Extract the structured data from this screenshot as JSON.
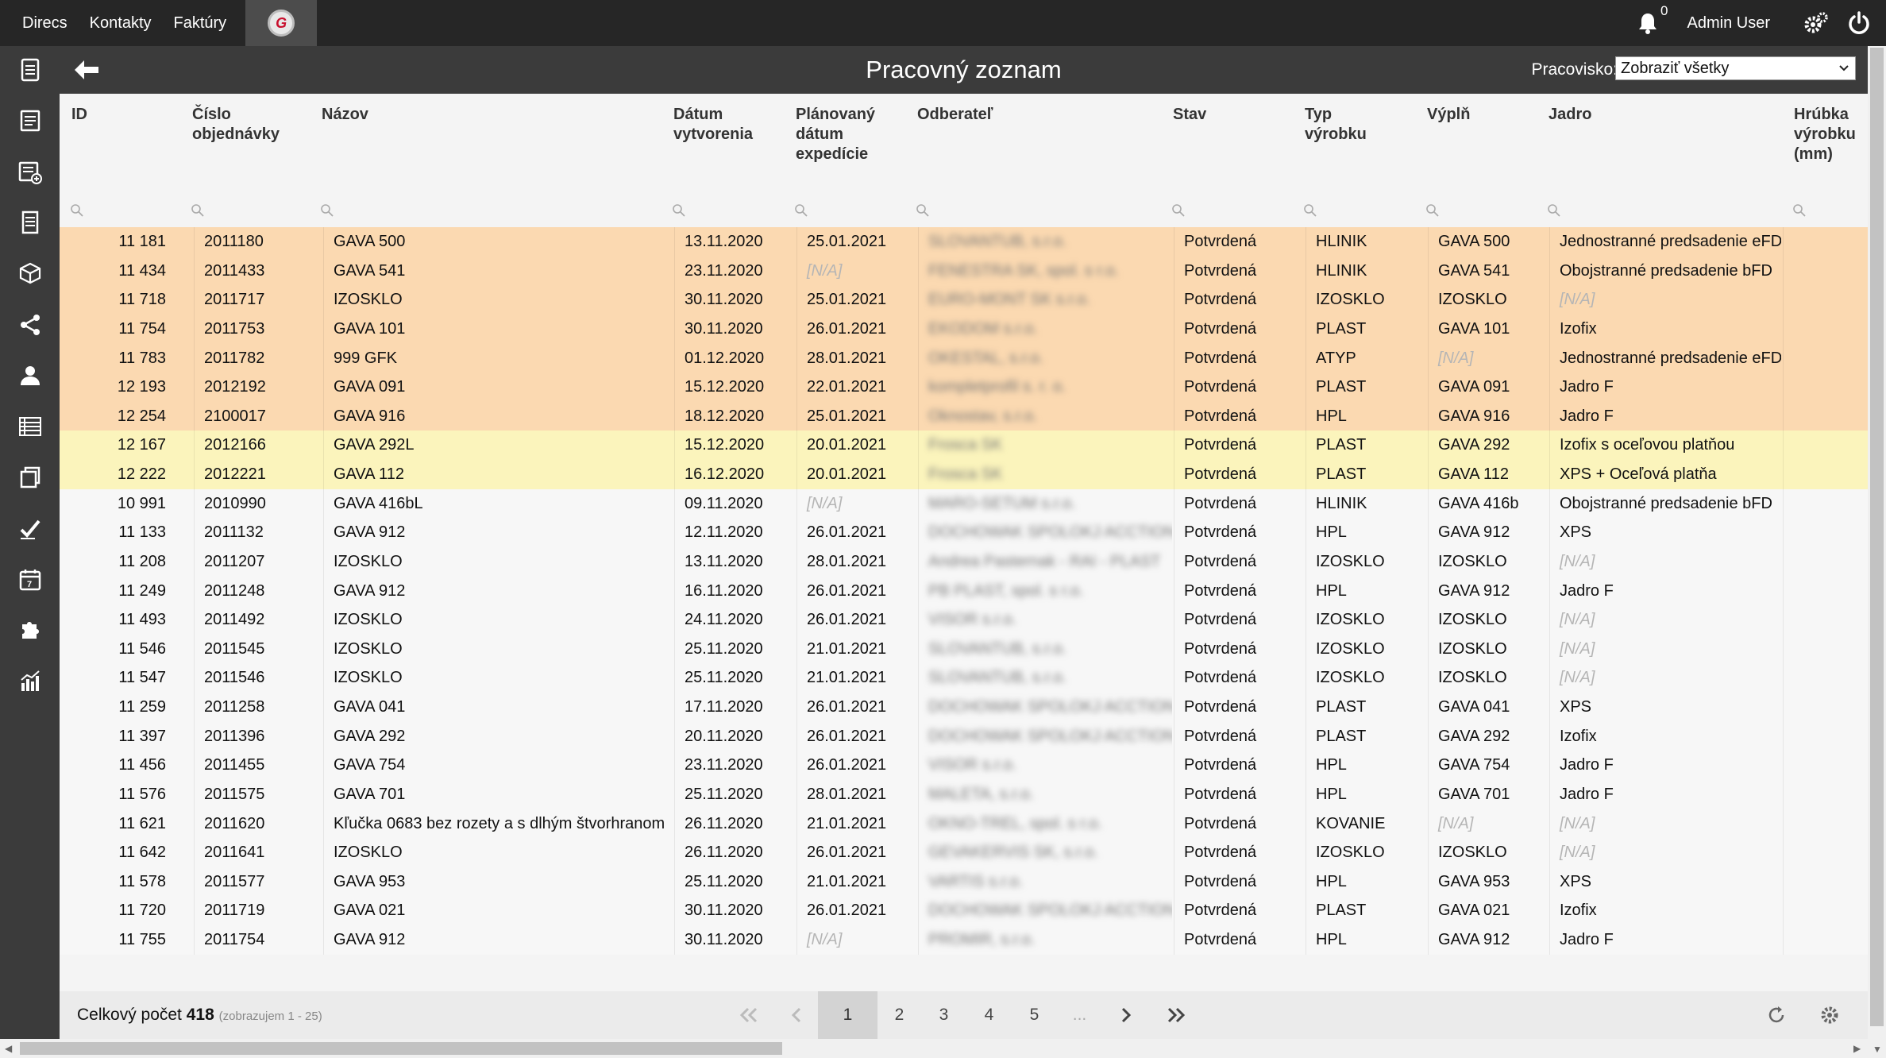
{
  "topnav": {
    "items": [
      "Direcs",
      "Kontakty",
      "Faktúry"
    ],
    "logo_letter": "G"
  },
  "topright": {
    "notifications": "0",
    "user": "Admin User"
  },
  "header": {
    "title": "Pracovný zoznam",
    "workspace_label": "Pracovisko:",
    "workspace_value": "Zobraziť všetky"
  },
  "columns": [
    "ID",
    "Číslo objednávky",
    "Názov",
    "Dátum vytvorenia",
    "Plánovaný dátum expedície",
    "Odberateľ",
    "Stav",
    "Typ výrobku",
    "Výplň",
    "Jadro",
    "Hrúbka výrobku (mm)"
  ],
  "column_lines": [
    [
      "ID"
    ],
    [
      "Číslo",
      "objednávky"
    ],
    [
      "Názov"
    ],
    [
      "Dátum",
      "vytvorenia"
    ],
    [
      "Plánovaný",
      "dátum",
      "expedície"
    ],
    [
      "Odberateľ"
    ],
    [
      "Stav"
    ],
    [
      "Typ",
      "výrobku"
    ],
    [
      "Výplň"
    ],
    [
      "Jadro"
    ],
    [
      "Hrúbka",
      "výrobku",
      "(mm)"
    ]
  ],
  "rows": [
    {
      "color": "orange",
      "id": "11 181",
      "order": "2011180",
      "name": "GAVA 500",
      "created": "13.11.2020",
      "planned": "25.01.2021",
      "customer": "SLOVANTUB, s.r.o.",
      "status": "Potvrdená",
      "type": "HLINIK",
      "fill": "GAVA 500",
      "core": "Jednostranné predsadenie eFD"
    },
    {
      "color": "orange",
      "id": "11 434",
      "order": "2011433",
      "name": "GAVA 541",
      "created": "23.11.2020",
      "planned": "[N/A]",
      "customer": "FENESTRA SK, spol. s r.o.",
      "status": "Potvrdená",
      "type": "HLINIK",
      "fill": "GAVA 541",
      "core": "Obojstranné predsadenie bFD"
    },
    {
      "color": "orange",
      "id": "11 718",
      "order": "2011717",
      "name": "IZOSKLO",
      "created": "30.11.2020",
      "planned": "25.01.2021",
      "customer": "EURO-MONT SK s.r.o.",
      "status": "Potvrdená",
      "type": "IZOSKLO",
      "fill": "IZOSKLO",
      "core": "[N/A]"
    },
    {
      "color": "orange",
      "id": "11 754",
      "order": "2011753",
      "name": "GAVA 101",
      "created": "30.11.2020",
      "planned": "26.01.2021",
      "customer": "EKODOM s.r.o.",
      "status": "Potvrdená",
      "type": "PLAST",
      "fill": "GAVA 101",
      "core": "Izofix"
    },
    {
      "color": "orange",
      "id": "11 783",
      "order": "2011782",
      "name": "999 GFK",
      "created": "01.12.2020",
      "planned": "28.01.2021",
      "customer": "OKESTAL, s.r.o.",
      "status": "Potvrdená",
      "type": "ATYP",
      "fill": "[N/A]",
      "core": "Jednostranné predsadenie eFD"
    },
    {
      "color": "orange",
      "id": "12 193",
      "order": "2012192",
      "name": "GAVA 091",
      "created": "15.12.2020",
      "planned": "22.01.2021",
      "customer": "kompletprofil s. r. o.",
      "status": "Potvrdená",
      "type": "PLAST",
      "fill": "GAVA 091",
      "core": "Jadro F"
    },
    {
      "color": "orange",
      "id": "12 254",
      "order": "2100017",
      "name": "GAVA 916",
      "created": "18.12.2020",
      "planned": "25.01.2021",
      "customer": "Oknostav, s.r.o.",
      "status": "Potvrdená",
      "type": "HPL",
      "fill": "GAVA 916",
      "core": "Jadro F"
    },
    {
      "color": "yellow",
      "id": "12 167",
      "order": "2012166",
      "name": "GAVA 292L",
      "created": "15.12.2020",
      "planned": "20.01.2021",
      "customer": "Frosca SK",
      "status": "Potvrdená",
      "type": "PLAST",
      "fill": "GAVA 292",
      "core": "Izofix s oceľovou platňou"
    },
    {
      "color": "yellow",
      "id": "12 222",
      "order": "2012221",
      "name": "GAVA 112",
      "created": "16.12.2020",
      "planned": "20.01.2021",
      "customer": "Frosca SK",
      "status": "Potvrdená",
      "type": "PLAST",
      "fill": "GAVA 112",
      "core": "XPS + Oceľová platňa"
    },
    {
      "color": "plain",
      "id": "10 991",
      "order": "2010990",
      "name": "GAVA 416bL",
      "created": "09.11.2020",
      "planned": "[N/A]",
      "customer": "MARO-SETUM s.r.o.",
      "status": "Potvrdená",
      "type": "HLINIK",
      "fill": "GAVA 416b",
      "core": "Obojstranné predsadenie bFD"
    },
    {
      "color": "plain",
      "id": "11 133",
      "order": "2011132",
      "name": "GAVA 912",
      "created": "12.11.2020",
      "planned": "26.01.2021",
      "customer": "DOCHOWAK SPOLOKJ ACCTION",
      "status": "Potvrdená",
      "type": "HPL",
      "fill": "GAVA 912",
      "core": "XPS"
    },
    {
      "color": "plain",
      "id": "11 208",
      "order": "2011207",
      "name": "IZOSKLO",
      "created": "13.11.2020",
      "planned": "28.01.2021",
      "customer": "Andrea Pasternak - RAI - PLAST",
      "status": "Potvrdená",
      "type": "IZOSKLO",
      "fill": "IZOSKLO",
      "core": "[N/A]"
    },
    {
      "color": "plain",
      "id": "11 249",
      "order": "2011248",
      "name": "GAVA 912",
      "created": "16.11.2020",
      "planned": "26.01.2021",
      "customer": "PB PLAST, spol. s r.o.",
      "status": "Potvrdená",
      "type": "HPL",
      "fill": "GAVA 912",
      "core": "Jadro F"
    },
    {
      "color": "plain",
      "id": "11 493",
      "order": "2011492",
      "name": "IZOSKLO",
      "created": "24.11.2020",
      "planned": "26.01.2021",
      "customer": "VISOR s.r.o.",
      "status": "Potvrdená",
      "type": "IZOSKLO",
      "fill": "IZOSKLO",
      "core": "[N/A]"
    },
    {
      "color": "plain",
      "id": "11 546",
      "order": "2011545",
      "name": "IZOSKLO",
      "created": "25.11.2020",
      "planned": "21.01.2021",
      "customer": "SLOVANTUB, s.r.o.",
      "status": "Potvrdená",
      "type": "IZOSKLO",
      "fill": "IZOSKLO",
      "core": "[N/A]"
    },
    {
      "color": "plain",
      "id": "11 547",
      "order": "2011546",
      "name": "IZOSKLO",
      "created": "25.11.2020",
      "planned": "21.01.2021",
      "customer": "SLOVANTUB, s.r.o.",
      "status": "Potvrdená",
      "type": "IZOSKLO",
      "fill": "IZOSKLO",
      "core": "[N/A]"
    },
    {
      "color": "plain",
      "id": "11 259",
      "order": "2011258",
      "name": "GAVA 041",
      "created": "17.11.2020",
      "planned": "26.01.2021",
      "customer": "DOCHOWAK SPOLOKJ ACCTION",
      "status": "Potvrdená",
      "type": "PLAST",
      "fill": "GAVA 041",
      "core": "XPS"
    },
    {
      "color": "plain",
      "id": "11 397",
      "order": "2011396",
      "name": "GAVA 292",
      "created": "20.11.2020",
      "planned": "26.01.2021",
      "customer": "DOCHOWAK SPOLOKJ ACCTION",
      "status": "Potvrdená",
      "type": "PLAST",
      "fill": "GAVA 292",
      "core": "Izofix"
    },
    {
      "color": "plain",
      "id": "11 456",
      "order": "2011455",
      "name": "GAVA 754",
      "created": "23.11.2020",
      "planned": "26.01.2021",
      "customer": "VISOR s.r.o.",
      "status": "Potvrdená",
      "type": "HPL",
      "fill": "GAVA 754",
      "core": "Jadro F"
    },
    {
      "color": "plain",
      "id": "11 576",
      "order": "2011575",
      "name": "GAVA 701",
      "created": "25.11.2020",
      "planned": "28.01.2021",
      "customer": "MALETA, s.r.o.",
      "status": "Potvrdená",
      "type": "HPL",
      "fill": "GAVA 701",
      "core": "Jadro F"
    },
    {
      "color": "plain",
      "id": "11 621",
      "order": "2011620",
      "name": "Kľučka 0683 bez rozety a s dlhým štvorhranom",
      "created": "26.11.2020",
      "planned": "21.01.2021",
      "customer": "OKNO-TREL, spol. s r.o.",
      "status": "Potvrdená",
      "type": "KOVANIE",
      "fill": "[N/A]",
      "core": "[N/A]"
    },
    {
      "color": "plain",
      "id": "11 642",
      "order": "2011641",
      "name": "IZOSKLO",
      "created": "26.11.2020",
      "planned": "26.01.2021",
      "customer": "GEVAKERVIS SK, s.r.o.",
      "status": "Potvrdená",
      "type": "IZOSKLO",
      "fill": "IZOSKLO",
      "core": "[N/A]"
    },
    {
      "color": "plain",
      "id": "11 578",
      "order": "2011577",
      "name": "GAVA 953",
      "created": "25.11.2020",
      "planned": "21.01.2021",
      "customer": "VARTIS s.r.o.",
      "status": "Potvrdená",
      "type": "HPL",
      "fill": "GAVA 953",
      "core": "XPS"
    },
    {
      "color": "plain",
      "id": "11 720",
      "order": "2011719",
      "name": "GAVA 021",
      "created": "30.11.2020",
      "planned": "26.01.2021",
      "customer": "DOCHOWAK SPOLOKJ ACCTION",
      "status": "Potvrdená",
      "type": "PLAST",
      "fill": "GAVA 021",
      "core": "Izofix"
    },
    {
      "color": "plain",
      "id": "11 755",
      "order": "2011754",
      "name": "GAVA 912",
      "created": "30.11.2020",
      "planned": "[N/A]",
      "customer": "PROMIR, s.r.o.",
      "status": "Potvrdená",
      "type": "HPL",
      "fill": "GAVA 912",
      "core": "Jadro F"
    }
  ],
  "footer": {
    "total_label": "Celkový počet",
    "total_value": "418",
    "showing": "(zobrazujem 1 - 25)",
    "pages": [
      "1",
      "2",
      "3",
      "4",
      "5",
      "..."
    ],
    "active_page": "1"
  },
  "colors": {
    "topbar": "#262626",
    "sidebar": "#3b3b3b",
    "row_orange": "#fbd9b1",
    "row_yellow": "#fbf4bc",
    "row_plain": "#f7f7f7",
    "logo_red": "#c8102e"
  },
  "sidebar_icons": [
    "document-icon",
    "list-document-icon",
    "add-list-icon",
    "notes-icon",
    "box-icon",
    "share-icon",
    "user-icon",
    "table-icon",
    "copy-icon",
    "check-icon",
    "calendar-icon",
    "puzzle-icon",
    "chart-icon"
  ]
}
